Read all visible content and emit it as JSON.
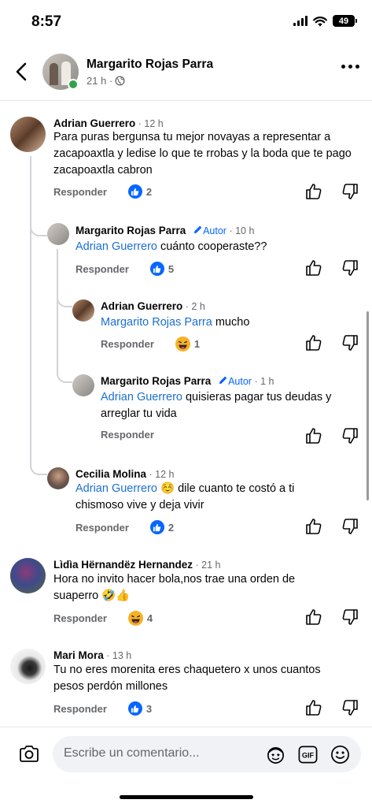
{
  "status_bar": {
    "time": "8:57",
    "battery": "49"
  },
  "header": {
    "name": "Margarito Rojas Parra",
    "time": "21 h ·"
  },
  "comments": [
    {
      "name": "Adrian Guerrero",
      "time": " · 12 h",
      "text": "Para puras bergunsa tu mejor novayas a representar a zacapoaxtla y ledise lo que te rrobas y la boda que te pago zacapoaxtla cabron",
      "respond": "Responder",
      "reaction": "like",
      "count": "2"
    },
    {
      "name": "Margarito Rojas Parra",
      "badge": "Autor",
      "time": " · 10 h",
      "mention": "Adrian Guerrero",
      "text": " cuánto cooperaste??",
      "respond": "Responder",
      "reaction": "like",
      "count": "5"
    },
    {
      "name": "Adrian Guerrero",
      "time": " · 2 h",
      "mention": "Margarito Rojas Parra",
      "text": " mucho",
      "respond": "Responder",
      "reaction": "haha",
      "count": "1"
    },
    {
      "name": "Margarito Rojas Parra",
      "badge": "Autor",
      "time": " · 1 h",
      "mention": "Adrian Guerrero",
      "text": " quisieras pagar tus deudas y arreglar tu vida",
      "respond": "Responder"
    },
    {
      "name": "Cecilia Molina",
      "time": " · 12 h",
      "mention": "Adrian Guerrero",
      "text": " ☺️ dile cuanto te costó a ti chismoso vive y deja vivir",
      "respond": "Responder",
      "reaction": "like",
      "count": "2"
    },
    {
      "name": "Lìdìa Hërnandëz Hernandez",
      "time": " · 21 h",
      "text": "Hora no invito hacer bola,nos trae una orden de suaperro 🤣👍",
      "respond": "Responder",
      "reaction": "haha",
      "count": "4"
    },
    {
      "name": "Mari Mora",
      "time": " · 13 h",
      "text": "Tu no eres morenita eres chaquetero x unos cuantos pesos perdón millones",
      "respond": "Responder",
      "reaction": "like",
      "count": "3"
    }
  ],
  "composer": {
    "placeholder": "Escribe un comentario..."
  },
  "colors": {
    "accent": "#0866ff",
    "mention": "#1b6fd1",
    "muted": "#65676b",
    "online": "#31a24c"
  },
  "icons": [
    "back-icon",
    "more-icon",
    "like-icon",
    "dislike-icon",
    "camera-icon",
    "avatar-sticker-icon",
    "gif-icon",
    "emoji-icon",
    "pencil-icon",
    "globe-icon"
  ]
}
